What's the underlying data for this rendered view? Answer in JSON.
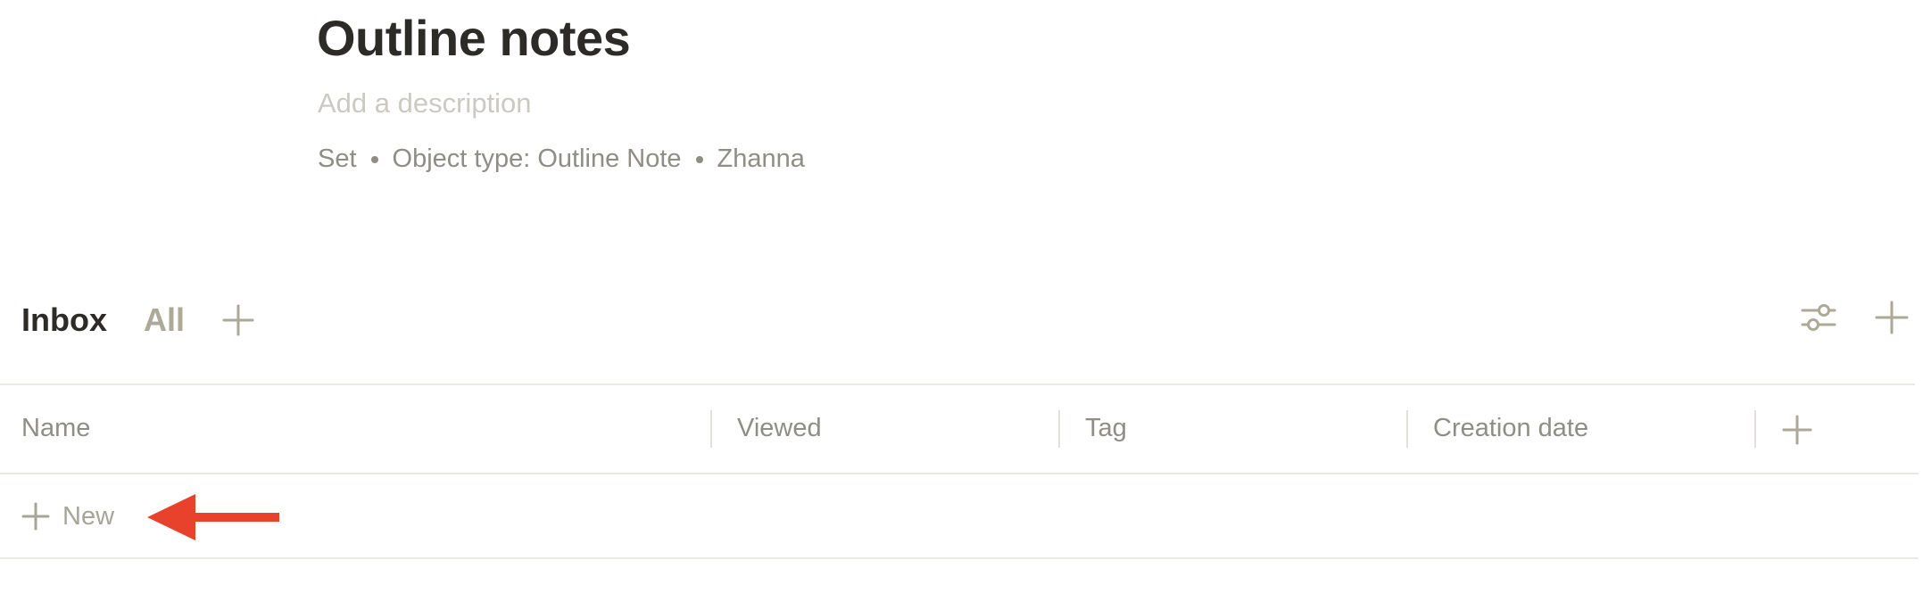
{
  "page": {
    "title": "Outline notes",
    "description_placeholder": "Add a description",
    "meta": [
      "Set",
      "Object type: Outline Note",
      "Zhanna"
    ]
  },
  "views": {
    "tabs": [
      {
        "label": "Inbox",
        "active": true
      },
      {
        "label": "All",
        "active": false
      }
    ],
    "add_icon": "plus-icon"
  },
  "toolbar": {
    "icons": [
      "settings-sliders-icon",
      "plus-icon"
    ]
  },
  "table": {
    "columns": [
      "Name",
      "Viewed",
      "Tag",
      "Creation date"
    ],
    "add_column_icon": "plus-icon",
    "new_row_label": "New"
  },
  "annotation": {
    "arrow_color": "#e8412c"
  },
  "colors": {
    "text_primary": "#2c2b27",
    "text_secondary": "#8f8d85",
    "text_muted": "#cbc9c1",
    "tab_inactive": "#aca996",
    "divider": "#ebe9e2"
  }
}
